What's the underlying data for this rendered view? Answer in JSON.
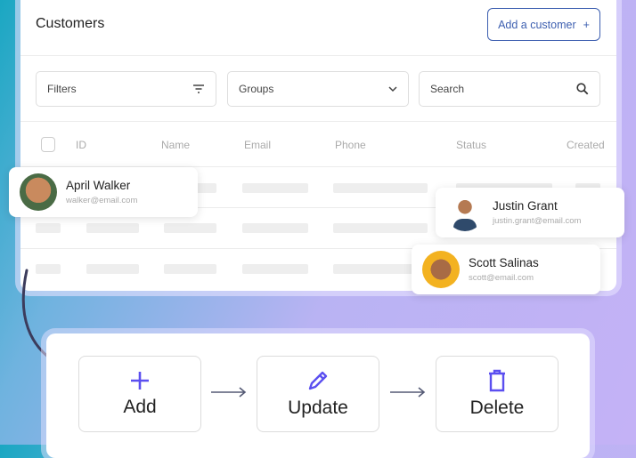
{
  "header": {
    "title": "Customers",
    "add_button": "Add a customer",
    "add_icon": "+"
  },
  "filters": {
    "filters_label": "Filters",
    "groups_label": "Groups",
    "search_placeholder": "Search"
  },
  "table": {
    "columns": [
      "ID",
      "Name",
      "Email",
      "Phone",
      "Status",
      "Created"
    ]
  },
  "contacts": [
    {
      "name": "April Walker",
      "email": "walker@email.com"
    },
    {
      "name": "Justin Grant",
      "email": "justin.grant@email.com"
    },
    {
      "name": "Scott Salinas",
      "email": "scott@email.com"
    }
  ],
  "actions": [
    {
      "label": "Add",
      "icon": "plus-icon"
    },
    {
      "label": "Update",
      "icon": "pencil-icon"
    },
    {
      "label": "Delete",
      "icon": "trash-icon"
    }
  ],
  "colors": {
    "accent": "#5b4ff0",
    "brand": "#3d5fb0"
  }
}
